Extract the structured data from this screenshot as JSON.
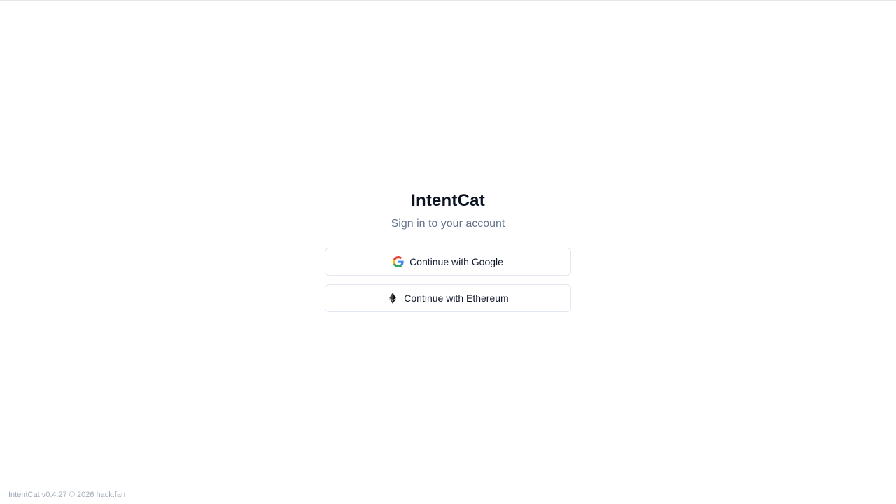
{
  "app": {
    "title": "IntentCat",
    "subtitle": "Sign in to your account"
  },
  "auth": {
    "google_label": "Continue with Google",
    "google_icon": "google-icon",
    "ethereum_label": "Continue with Ethereum",
    "ethereum_icon": "ethereum-icon"
  },
  "footer": {
    "text": "IntentCat v0.4.27 © 2026 hack.fan"
  },
  "colors": {
    "title": "#0b1220",
    "subtitle": "#64748b",
    "button_border": "#e2e8f0",
    "footer": "#a3acb9"
  }
}
